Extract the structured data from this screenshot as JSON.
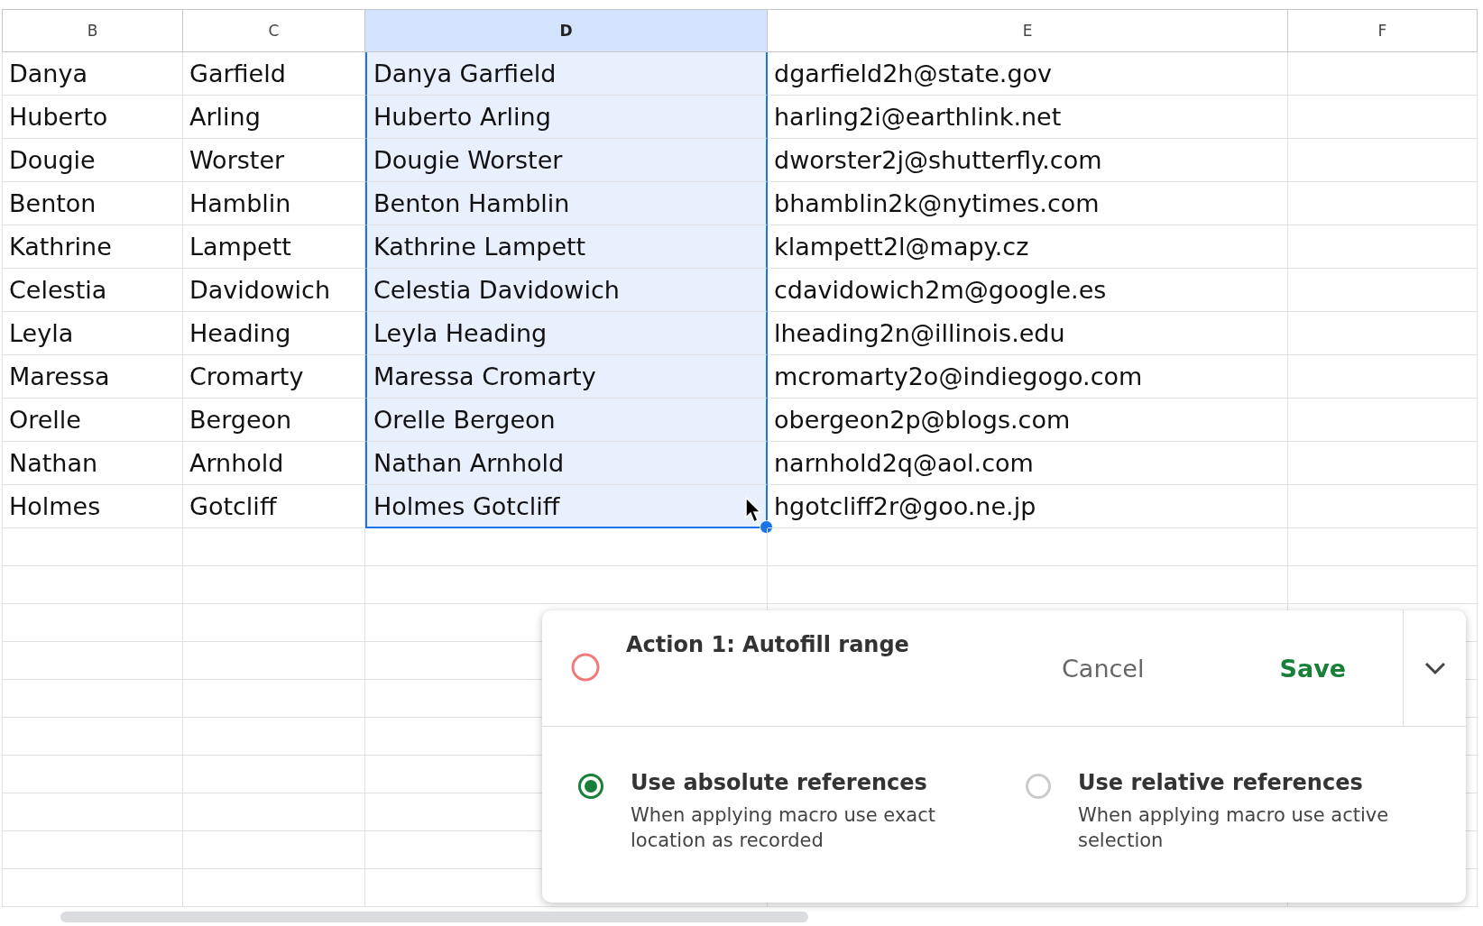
{
  "columns": [
    {
      "label": "B",
      "selected": false
    },
    {
      "label": "C",
      "selected": false
    },
    {
      "label": "D",
      "selected": true
    },
    {
      "label": "E",
      "selected": false
    },
    {
      "label": "F",
      "selected": false
    }
  ],
  "rows": [
    [
      "Danya",
      "Garfield",
      "Danya Garfield",
      "dgarfield2h@state.gov"
    ],
    [
      "Huberto",
      "Arling",
      "Huberto Arling",
      "harling2i@earthlink.net"
    ],
    [
      "Dougie",
      "Worster",
      "Dougie Worster",
      "dworster2j@shutterfly.com"
    ],
    [
      "Benton",
      "Hamblin",
      "Benton Hamblin",
      "bhamblin2k@nytimes.com"
    ],
    [
      "Kathrine",
      "Lampett",
      "Kathrine Lampett",
      "klampett2l@mapy.cz"
    ],
    [
      "Celestia",
      "Davidowich",
      "Celestia Davidowich",
      "cdavidowich2m@google.es"
    ],
    [
      "Leyla",
      "Heading",
      "Leyla Heading",
      "lheading2n@illinois.edu"
    ],
    [
      "Maressa",
      "Cromarty",
      "Maressa Cromarty",
      "mcromarty2o@indiegogo.com"
    ],
    [
      "Orelle",
      "Bergeon",
      "Orelle Bergeon",
      "obergeon2p@blogs.com"
    ],
    [
      "Nathan",
      "Arnhold",
      "Nathan Arnhold",
      "narnhold2q@aol.com"
    ],
    [
      "Holmes",
      "Gotcliff",
      "Holmes Gotcliff",
      "hgotcliff2r@goo.ne.jp"
    ]
  ],
  "macro_panel": {
    "title": "Action 1: Autofill range",
    "cancel": "Cancel",
    "save": "Save",
    "options": [
      {
        "label": "Use absolute references",
        "description": "When applying macro use exact location as recorded",
        "selected": true
      },
      {
        "label": "Use relative references",
        "description": "When applying macro use active selection",
        "selected": false
      }
    ]
  }
}
